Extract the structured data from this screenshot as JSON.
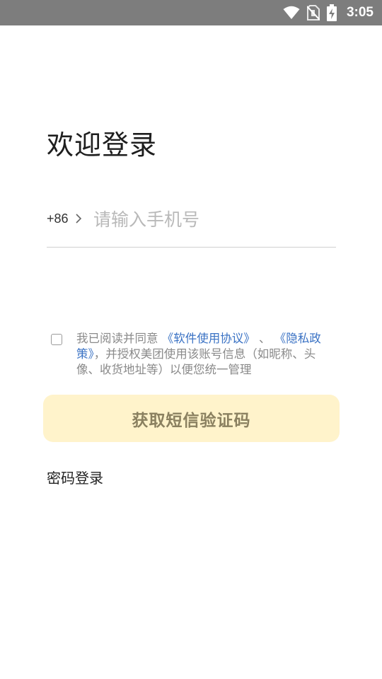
{
  "status_bar": {
    "time": "3:05",
    "icons": [
      "wifi-icon",
      "no-sim-icon",
      "battery-charging-icon"
    ]
  },
  "login": {
    "title": "欢迎登录",
    "country_code": "+86",
    "phone_placeholder": "请输入手机号",
    "phone_value": ""
  },
  "agreement": {
    "checked": false,
    "prefix": "我已阅读并同意 ",
    "software_agreement": "《软件使用协议》",
    "separator": "、",
    "privacy_policy": "《隐私政策》",
    "suffix": "，并授权美团使用该账号信息（如昵称、头像、收货地址等）以便您统一管理"
  },
  "actions": {
    "get_sms_code": "获取短信验证码",
    "password_login": "密码登录"
  },
  "colors": {
    "status_bar": "#7d7d7d",
    "button_bg": "#fff3cb",
    "button_text": "#8a8060",
    "link": "#3a72c4"
  }
}
